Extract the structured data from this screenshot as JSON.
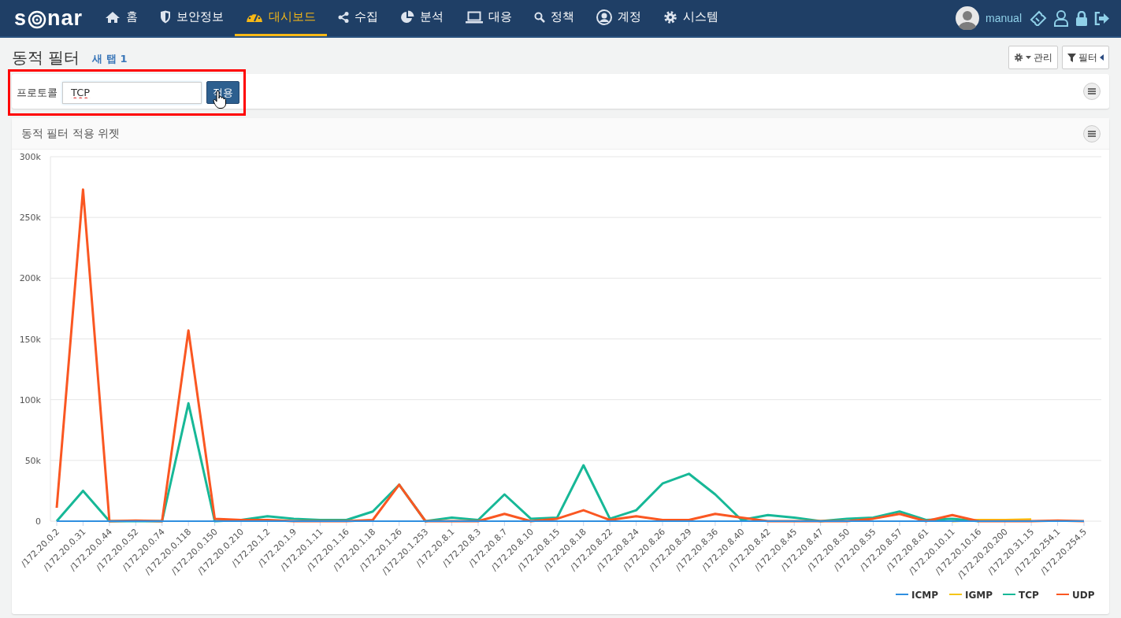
{
  "navbar": {
    "logo": {
      "prefix": "s",
      "suffix": "nar"
    },
    "items": [
      {
        "label": "홈",
        "selected": false
      },
      {
        "label": "보안정보",
        "selected": false
      },
      {
        "label": "대시보드",
        "selected": true
      },
      {
        "label": "수집",
        "selected": false
      },
      {
        "label": "분석",
        "selected": false
      },
      {
        "label": "대응",
        "selected": false
      },
      {
        "label": "정책",
        "selected": false
      },
      {
        "label": "계정",
        "selected": false
      },
      {
        "label": "시스템",
        "selected": false
      }
    ],
    "user": "manual"
  },
  "page": {
    "title": "동적 필터",
    "tab": "새 탭 1",
    "buttons": [
      {
        "label": "관리",
        "kind": "manage"
      },
      {
        "label": "필터",
        "kind": "filter"
      }
    ]
  },
  "filter": {
    "label": "프로토콜",
    "value": "TCP",
    "button": "적용"
  },
  "widget": {
    "title": "동적 필터 적용 위젯",
    "chart_data": {
      "type": "line",
      "categories": [
        "/172.20.0.2",
        "/172.20.0.31",
        "/172.20.0.44",
        "/172.20.0.52",
        "/172.20.0.74",
        "/172.20.0.118",
        "/172.20.0.150",
        "/172.20.0.210",
        "/172.20.1.2",
        "/172.20.1.9",
        "/172.20.1.11",
        "/172.20.1.16",
        "/172.20.1.18",
        "/172.20.1.26",
        "/172.20.1.253",
        "/172.20.8.1",
        "/172.20.8.3",
        "/172.20.8.7",
        "/172.20.8.10",
        "/172.20.8.15",
        "/172.20.8.18",
        "/172.20.8.22",
        "/172.20.8.24",
        "/172.20.8.26",
        "/172.20.8.29",
        "/172.20.8.36",
        "/172.20.8.40",
        "/172.20.8.42",
        "/172.20.8.45",
        "/172.20.8.47",
        "/172.20.8.50",
        "/172.20.8.55",
        "/172.20.8.57",
        "/172.20.8.61",
        "/172.20.10.11",
        "/172.20.10.16",
        "/172.20.20.200",
        "/172.20.31.15",
        "/172.20.254.1",
        "/172.20.254.5"
      ],
      "ylim": [
        0,
        300000
      ],
      "grid": true,
      "legend": "bottom-right",
      "yticks": [
        {
          "value": 0,
          "label": "0"
        },
        {
          "value": 50000,
          "label": "50k"
        },
        {
          "value": 100000,
          "label": "100k"
        },
        {
          "value": 150000,
          "label": "150k"
        },
        {
          "value": 200000,
          "label": "200k"
        },
        {
          "value": 250000,
          "label": "250k"
        },
        {
          "value": 300000,
          "label": "300k"
        }
      ],
      "series": [
        {
          "name": "ICMP",
          "color": "#2f8fe0",
          "values": [
            0,
            0,
            0,
            0,
            0,
            0,
            0,
            0,
            0,
            0,
            0,
            0,
            0,
            0,
            0,
            0,
            0,
            0,
            0,
            0,
            0,
            0,
            0,
            0,
            0,
            0,
            0,
            0,
            0,
            0,
            0,
            0,
            0,
            0,
            0,
            0,
            0,
            0,
            0,
            0
          ]
        },
        {
          "name": "IGMP",
          "color": "#f5c518",
          "values": [
            null,
            null,
            null,
            null,
            null,
            null,
            null,
            null,
            null,
            null,
            null,
            null,
            null,
            null,
            null,
            null,
            null,
            null,
            null,
            null,
            null,
            null,
            null,
            null,
            null,
            null,
            null,
            null,
            null,
            null,
            null,
            null,
            null,
            null,
            0,
            1000,
            1000,
            1500,
            null,
            null
          ]
        },
        {
          "name": "TCP",
          "color": "#17b897",
          "values": [
            0,
            25000,
            0,
            0,
            0,
            97000,
            0,
            1000,
            4000,
            2000,
            1000,
            1000,
            8000,
            30000,
            0,
            3000,
            1000,
            22000,
            2000,
            3000,
            46000,
            2000,
            9000,
            31000,
            39000,
            22000,
            1000,
            5000,
            3000,
            0,
            2000,
            3000,
            8000,
            1000,
            2000,
            0,
            null,
            null,
            null,
            null
          ]
        },
        {
          "name": "UDP",
          "color": "#fa5722",
          "values": [
            11000,
            273000,
            0,
            500,
            0,
            157000,
            2000,
            1000,
            1000,
            0,
            0,
            0,
            1000,
            30000,
            0,
            0,
            0,
            6000,
            0,
            2000,
            9000,
            1000,
            4000,
            1000,
            1000,
            6000,
            3000,
            0,
            0,
            0,
            0,
            2000,
            6000,
            0,
            5000,
            0,
            0,
            0,
            500,
            0
          ]
        }
      ]
    }
  }
}
